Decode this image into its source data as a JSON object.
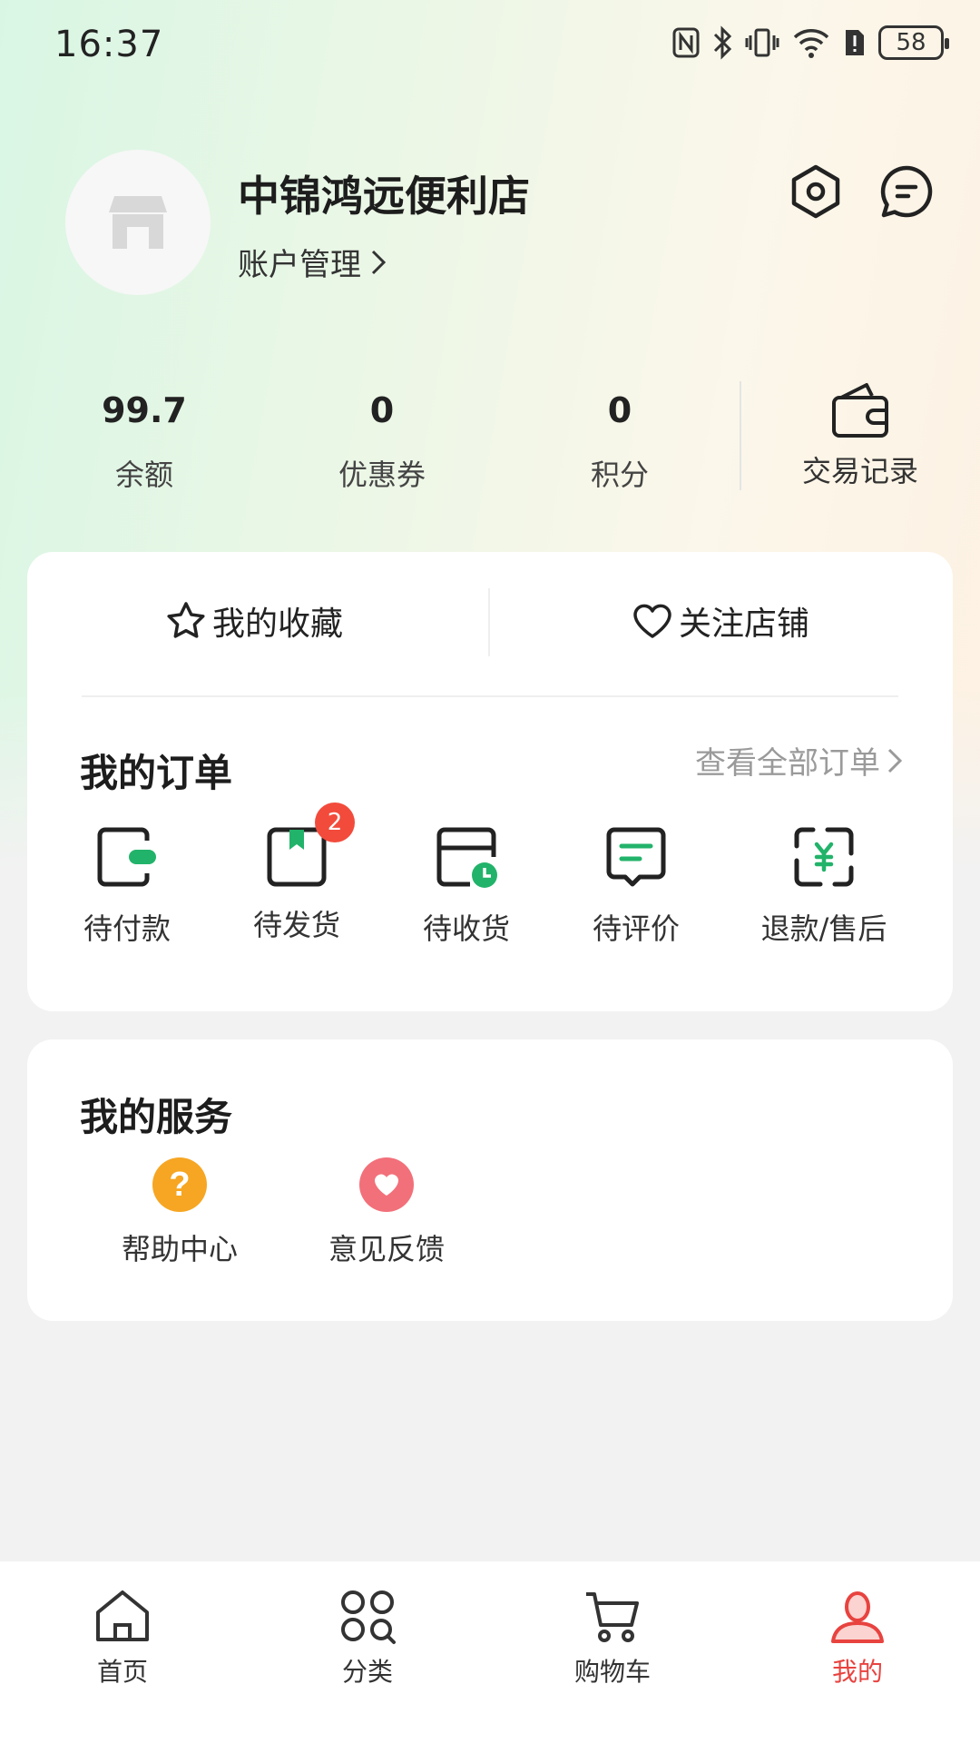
{
  "status_bar": {
    "time": "16:37",
    "battery": "58"
  },
  "profile": {
    "store_name": "中锦鸿远便利店",
    "account_label": "账户管理"
  },
  "stats": [
    {
      "value": "99.7",
      "label": "余额"
    },
    {
      "value": "0",
      "label": "优惠券"
    },
    {
      "value": "0",
      "label": "积分"
    }
  ],
  "transactions": {
    "label": "交易记录"
  },
  "quick_links": {
    "favorites": "我的收藏",
    "follow_stores": "关注店铺"
  },
  "orders": {
    "title": "我的订单",
    "view_all": "查看全部订单",
    "items": [
      {
        "label": "待付款",
        "icon": "wallet-icon"
      },
      {
        "label": "待发货",
        "icon": "package-icon",
        "badge": "2"
      },
      {
        "label": "待收货",
        "icon": "delivery-clock-icon"
      },
      {
        "label": "待评价",
        "icon": "review-icon"
      },
      {
        "label": "退款/售后",
        "icon": "refund-icon"
      }
    ]
  },
  "services": {
    "title": "我的服务",
    "items": [
      {
        "label": "帮助中心",
        "icon": "help-icon"
      },
      {
        "label": "意见反馈",
        "icon": "feedback-icon"
      }
    ]
  },
  "tabbar": {
    "items": [
      {
        "label": "首页",
        "icon": "home-icon"
      },
      {
        "label": "分类",
        "icon": "category-icon"
      },
      {
        "label": "购物车",
        "icon": "cart-icon"
      },
      {
        "label": "我的",
        "icon": "profile-icon",
        "active": true
      }
    ]
  },
  "colors": {
    "accent_green": "#22b36a",
    "badge_red": "#f24b3c",
    "active_tab": "#e8433f",
    "help_orange": "#f6a623",
    "feedback_pink": "#f2707a"
  }
}
